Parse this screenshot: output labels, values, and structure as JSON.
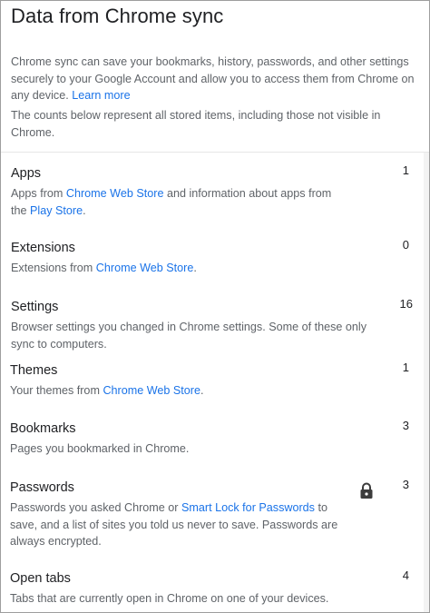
{
  "header": {
    "title": "Data from Chrome sync"
  },
  "intro": {
    "text": "Chrome sync can save your bookmarks, history, passwords, and other settings securely to your Google Account and allow you to access them from Chrome on any device. ",
    "learn_more": "Learn more",
    "counts_note": "The counts below represent all stored items, including those not visible in Chrome."
  },
  "items": {
    "apps": {
      "title": "Apps",
      "count": "1",
      "desc_before": "Apps from ",
      "link1": "Chrome Web Store",
      "desc_middle": " and information about apps from the ",
      "link2": "Play Store",
      "desc_after": "."
    },
    "extensions": {
      "title": "Extensions",
      "count": "0",
      "desc_before": "Extensions from ",
      "link1": "Chrome Web Store",
      "desc_after": "."
    },
    "settings": {
      "title": "Settings",
      "count": "16",
      "desc": "Browser settings you changed in Chrome settings. Some of these only sync to computers."
    },
    "themes": {
      "title": "Themes",
      "count": "1",
      "desc_before": "Your themes from ",
      "link1": "Chrome Web Store",
      "desc_after": "."
    },
    "bookmarks": {
      "title": "Bookmarks",
      "count": "3",
      "desc": "Pages you bookmarked in Chrome."
    },
    "passwords": {
      "title": "Passwords",
      "count": "3",
      "icon": "lock-icon",
      "desc_before": "Passwords you asked Chrome or ",
      "link1": "Smart Lock for Passwords",
      "desc_after": " to save, and a list of sites you told us never to save. Passwords are always encrypted."
    },
    "open_tabs": {
      "title": "Open tabs",
      "count": "4",
      "desc": "Tabs that are currently open in Chrome on one of your devices."
    }
  },
  "colors": {
    "link": "#1a73e8",
    "text_primary": "#202124",
    "text_secondary": "#5f6368"
  }
}
